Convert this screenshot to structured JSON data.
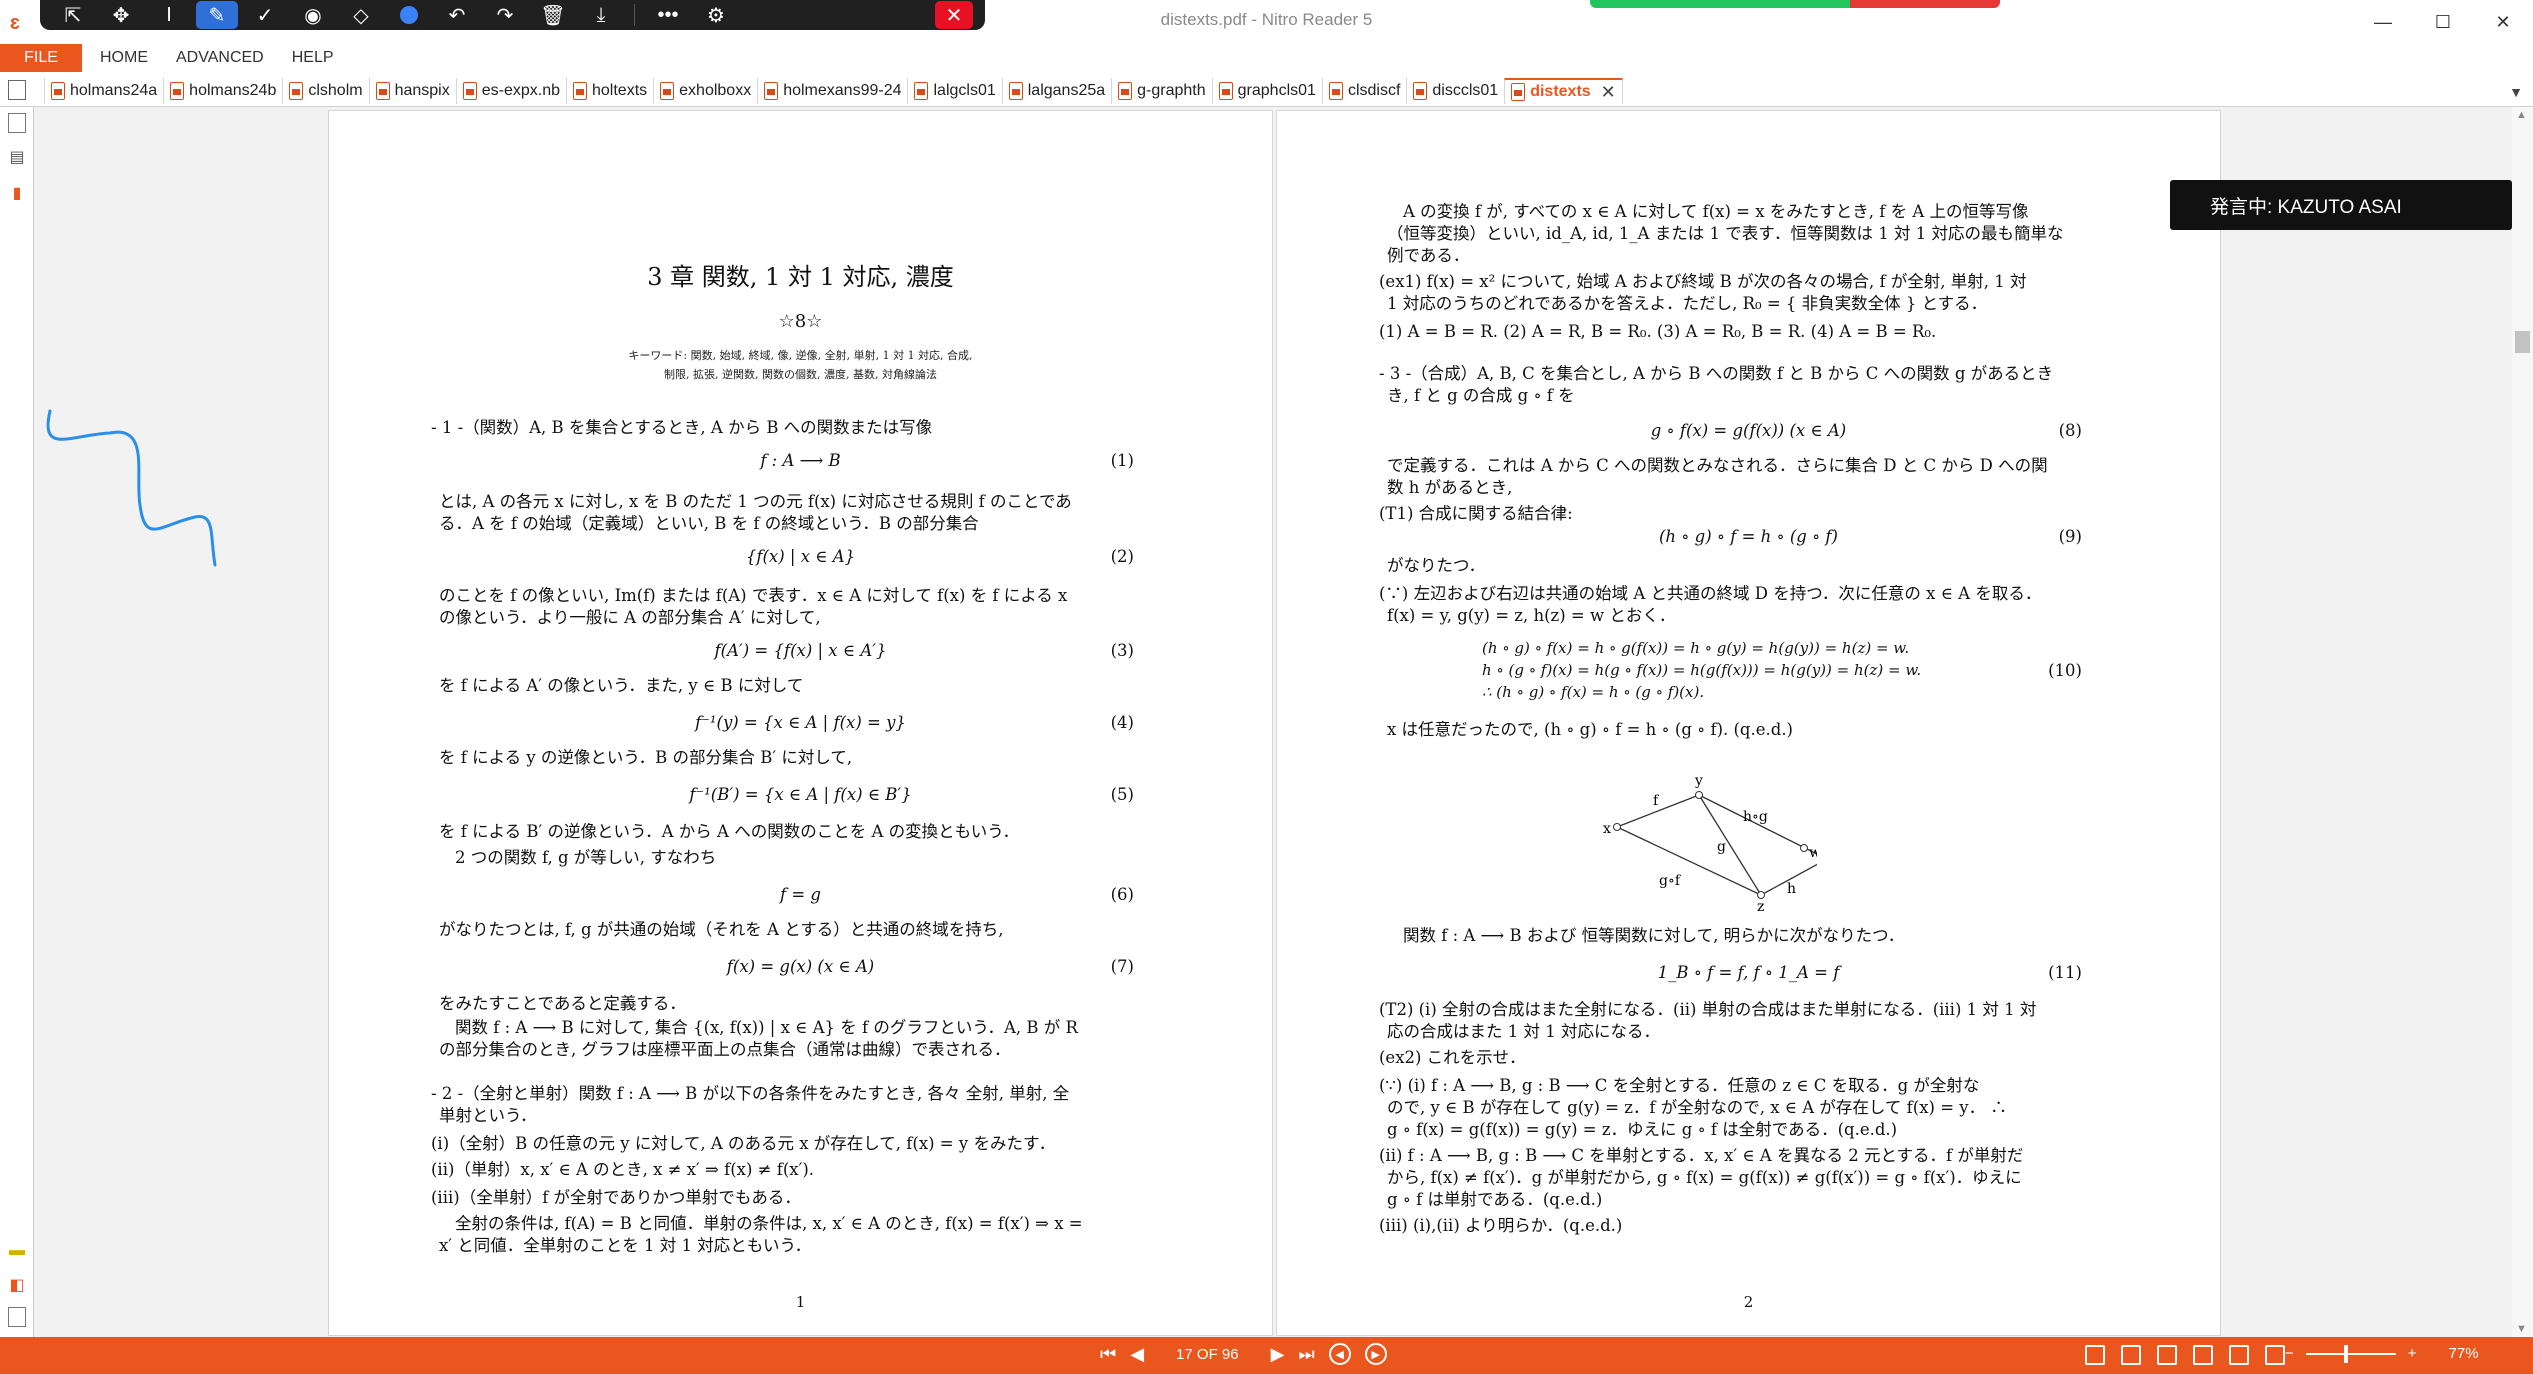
{
  "window": {
    "title": "distexts.pdf - Nitro Reader 5",
    "app_logo": "nitro-logo"
  },
  "pen_toolbar": {
    "icons": [
      "pointer-icon",
      "move-icon",
      "text-cursor-icon",
      "pen-icon",
      "check-icon",
      "stamp-icon",
      "eraser-icon",
      "color-dot-icon",
      "undo-icon",
      "redo-icon",
      "trash-icon",
      "download-icon",
      "more-icon",
      "user-settings-icon",
      "close-icon"
    ]
  },
  "menu": {
    "file": "FILE",
    "items": [
      "HOME",
      "ADVANCED",
      "HELP"
    ]
  },
  "tabs": [
    {
      "label": "holmans24a"
    },
    {
      "label": "holmans24b"
    },
    {
      "label": "clsholm"
    },
    {
      "label": "hanspix"
    },
    {
      "label": "es-expx.nb"
    },
    {
      "label": "holtexts"
    },
    {
      "label": "exholboxx"
    },
    {
      "label": "holmexans99-24"
    },
    {
      "label": "lalgcls01"
    },
    {
      "label": "lalgans25a"
    },
    {
      "label": "g-graphth"
    },
    {
      "label": "graphcls01"
    },
    {
      "label": "clsdiscf"
    },
    {
      "label": "disccls01"
    }
  ],
  "active_tab": {
    "label": "distexts",
    "close": "✕"
  },
  "speaker_overlay": {
    "text": "発言中: KAZUTO ASAI"
  },
  "page1": {
    "title": "3 章  関数, 1 対 1 対応, 濃度",
    "stars": "☆8☆",
    "keywords1": "キーワード: 関数, 始域, 終域, 像, 逆像, 全射, 単射, 1 対 1 対応, 合成,",
    "keywords2": "制限, 拡張, 逆関数, 関数の個数, 濃度, 基数, 対角線論法",
    "s1_head": "- 1 -（関数）A, B を集合とするとき, A から B への関数または写像",
    "eq1": "f : A ⟶ B",
    "eq1n": "(1)",
    "p1a": "とは, A の各元 x に対し, x を B のただ 1 つの元 f(x) に対応させる規則 f のことであ",
    "p1b": "る．A を f の始域（定義域）といい, B を f の終域という．B の部分集合",
    "eq2": "{f(x) | x ∈ A}",
    "eq2n": "(2)",
    "p2a": "のことを f の像といい, Im(f) または f(A) で表す．x ∈ A に対して f(x) を f による x",
    "p2b": "の像という．より一般に A の部分集合 A′ に対して,",
    "eq3": "f(A′) = {f(x) | x ∈ A′}",
    "eq3n": "(3)",
    "p3": "を f による A′ の像という．また, y ∈ B に対して",
    "eq4": "f⁻¹(y) = {x ∈ A | f(x) = y}",
    "eq4n": "(4)",
    "p4": "を f による y の逆像という．B の部分集合 B′ に対して,",
    "eq5": "f⁻¹(B′) = {x ∈ A | f(x) ∈ B′}",
    "eq5n": "(5)",
    "p5a": "を f による B′ の逆像という．A から A への関数のことを A の変換ともいう．",
    "p5b": "2 つの関数 f, g が等しい, すなわち",
    "eq6": "f = g",
    "eq6n": "(6)",
    "p6": "がなりたつとは, f, g が共通の始域（それを A とする）と共通の終域を持ち,",
    "eq7": "f(x) = g(x)      (x ∈ A)",
    "eq7n": "(7)",
    "p7a": "をみたすことであると定義する．",
    "p7b": "関数 f : A ⟶ B に対して, 集合 {(x, f(x)) | x ∈ A} を f のグラフという．A, B が R",
    "p7c": "の部分集合のとき, グラフは座標平面上の点集合（通常は曲線）で表される．",
    "s2a": "- 2 -（全射と単射）関数 f : A ⟶ B が以下の各条件をみたすとき, 各々 全射, 単射, 全",
    "s2b": "単射という．",
    "s2i": "(i)（全射）B の任意の元 y に対して, A のある元 x が存在して, f(x) = y をみたす．",
    "s2ii": "(ii)（単射）x, x′ ∈ A のとき, x ≠ x′ ⇒ f(x) ≠ f(x′).",
    "s2iii": "(iii)（全単射）f が全射でありかつ単射でもある．",
    "s2c": "全射の条件は, f(A) = B と同値．単射の条件は, x, x′ ∈ A のとき, f(x) = f(x′) ⇒ x =",
    "s2d": "x′ と同値．全単射のことを 1 対 1 対応ともいう．",
    "pageno": "1"
  },
  "page2": {
    "l1": "A の変換 f が, すべての x ∈ A に対して f(x) = x をみたすとき, f を A 上の恒等写像",
    "l2": "（恒等変換）といい, id_A, id, 1_A または 1 で表す．恒等関数は 1 対 1 対応の最も簡単な",
    "l3": "例である．",
    "ex1a": "(ex1) f(x) = x² について, 始域 A および終域 B が次の各々の場合, f が全射, 単射, 1 対",
    "ex1b": "1 対応のうちのどれであるかを答えよ．ただし, R₀ = { 非負実数全体 } とする．",
    "ex1c": "(1) A = B = R.  (2) A = R, B = R₀.  (3) A = R₀, B = R.  (4) A = B = R₀.",
    "s3a": "- 3 -（合成）A, B, C を集合とし, A から B への関数 f と B から C への関数 g があるとき",
    "s3b": "き, f と g の合成 g ∘ f を",
    "eq8": "g ∘ f(x) = g(f(x))      (x ∈ A)",
    "eq8n": "(8)",
    "s3c": "で定義する．これは A から C への関数とみなされる．さらに集合 D と C から D への関",
    "s3d": "数 h があるとき,",
    "t1": "(T1) 合成に関する結合律:",
    "eq9": "(h ∘ g) ∘ f = h ∘ (g ∘ f)",
    "eq9n": "(9)",
    "t1b": "がなりたつ．",
    "pr1": "(∵) 左辺および右辺は共通の始域 A と共通の終域 D を持つ．次に任意の x ∈ A を取る．",
    "pr2": "f(x) = y, g(y) = z, h(z) = w とおく．",
    "eq10a": "(h ∘ g) ∘ f(x) = h ∘ g(f(x)) = h ∘ g(y) = h(g(y)) = h(z) = w.",
    "eq10b": "h ∘ (g ∘ f)(x) = h(g ∘ f(x)) = h(g(f(x))) = h(g(y)) = h(z) = w.",
    "eq10c": "∴ (h ∘ g) ∘ f(x) = h ∘ (g ∘ f)(x).",
    "eq10n": "(10)",
    "pr3": "x は任意だったので, (h ∘ g) ∘ f = h ∘ (g ∘ f).  (q.e.d.)",
    "diagram": {
      "x": "x",
      "y": "y",
      "z": "z",
      "w": "w",
      "f": "f",
      "g": "g",
      "hog": "h∘g",
      "gof": "g∘f",
      "h": "h"
    },
    "id1": "関数 f : A ⟶ B および 恒等関数に対して, 明らかに次がなりたつ．",
    "eq11": "1_B ∘ f = f,      f ∘ 1_A = f",
    "eq11n": "(11)",
    "t2a": "(T2) (i) 全射の合成はまた全射になる．(ii) 単射の合成はまた単射になる．(iii) 1 対 1 対",
    "t2b": "応の合成はまた 1 対 1 対応になる．",
    "ex2": "(ex2) これを示せ．",
    "p1": "(∵) (i) f : A ⟶ B, g : B ⟶ C を全射とする．任意の z ∈ C を取る．g が全射な",
    "p2": "ので, y ∈ B が存在して g(y) = z．f が全射なので, x ∈ A が存在して f(x) = y．  ∴",
    "p3": "g ∘ f(x) = g(f(x)) = g(y) = z．ゆえに g ∘ f は全射である．(q.e.d.)",
    "p4": "(ii) f : A ⟶ B, g : B ⟶ C を単射とする．x, x′ ∈ A を異なる 2 元とする．f が単射だ",
    "p5": "から, f(x) ≠ f(x′)．g が単射だから, g ∘ f(x) = g(f(x)) ≠ g(f(x′)) = g ∘ f(x′)．ゆえに",
    "p6": "g ∘ f は単射である．(q.e.d.)",
    "p7": "(iii) (i),(ii) より明らか．(q.e.d.)",
    "pageno": "2"
  },
  "status": {
    "page_indicator": "17 OF 96",
    "zoom": "77%",
    "zoom_level": 0.45,
    "accent": "#e9571f"
  },
  "annotation": {
    "ink_color": "#2b8fe8"
  }
}
